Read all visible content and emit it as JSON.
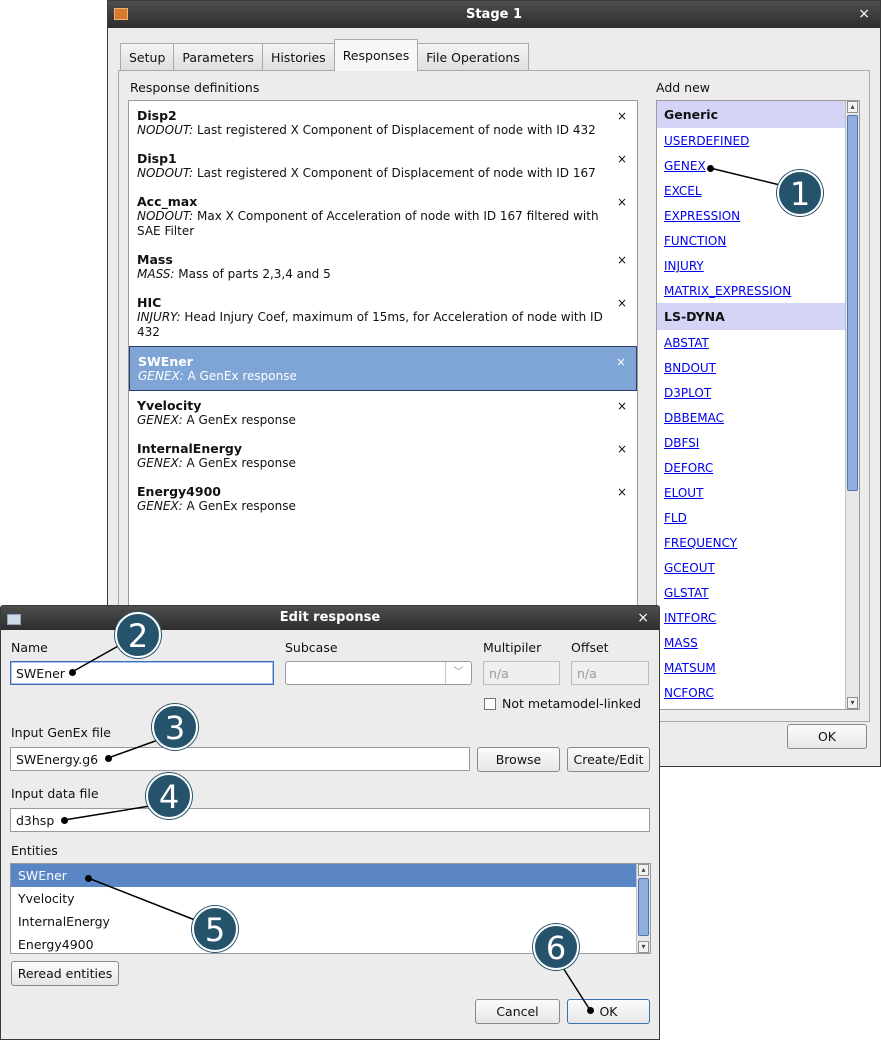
{
  "stage": {
    "title": "Stage 1",
    "close_glyph": "×",
    "tabs": [
      {
        "label": "Setup"
      },
      {
        "label": "Parameters"
      },
      {
        "label": "Histories"
      },
      {
        "label": "Responses",
        "active": true
      },
      {
        "label": "File Operations"
      }
    ],
    "response_definitions_label": "Response definitions",
    "add_new_label": "Add new",
    "remove_glyph": "×",
    "responses": [
      {
        "name": "Disp2",
        "type": "NODOUT:",
        "desc": "Last registered X Component of Displacement of node with ID 432"
      },
      {
        "name": "Disp1",
        "type": "NODOUT:",
        "desc": "Last registered X Component of Displacement of node with ID 167"
      },
      {
        "name": "Acc_max",
        "type": "NODOUT:",
        "desc": "Max X Component of Acceleration of node with ID 167 filtered with SAE Filter"
      },
      {
        "name": "Mass",
        "type": "MASS:",
        "desc": "Mass of parts 2,3,4 and 5"
      },
      {
        "name": "HIC",
        "type": "INJURY:",
        "desc": "Head Injury Coef, maximum of 15ms, for Acceleration of node with ID 432"
      },
      {
        "name": "SWEner",
        "type": "GENEX:",
        "desc": "A GenEx response",
        "selected": true
      },
      {
        "name": "Yvelocity",
        "type": "GENEX:",
        "desc": "A GenEx response"
      },
      {
        "name": "InternalEnergy",
        "type": "GENEX:",
        "desc": "A GenEx response"
      },
      {
        "name": "Energy4900",
        "type": "GENEX:",
        "desc": "A GenEx response"
      }
    ],
    "add_new": {
      "generic_header": "Generic",
      "generic": [
        "USERDEFINED",
        "GENEX",
        "EXCEL",
        "EXPRESSION",
        "FUNCTION",
        "INJURY",
        "MATRIX_EXPRESSION"
      ],
      "lsdyna_header": "LS-DYNA",
      "lsdyna": [
        "ABSTAT",
        "BNDOUT",
        "D3PLOT",
        "DBBEMAC",
        "DBFSI",
        "DEFORC",
        "ELOUT",
        "FLD",
        "FREQUENCY",
        "GCEOUT",
        "GLSTAT",
        "INTFORC",
        "MASS",
        "MATSUM",
        "NCFORC"
      ]
    },
    "ok_label": "OK"
  },
  "edit": {
    "title": "Edit response",
    "close_glyph": "×",
    "name_label": "Name",
    "name_value": "SWEner",
    "subcase_label": "Subcase",
    "subcase_value": "",
    "multiplier_label": "Multipiler",
    "multiplier_value": "n/a",
    "offset_label": "Offset",
    "offset_value": "n/a",
    "not_linked_label": "Not metamodel-linked",
    "genex_label": "Input GenEx file",
    "genex_value": "SWEnergy.g6",
    "browse_label": "Browse",
    "create_edit_label": "Create/Edit",
    "data_label": "Input data file",
    "data_value": "d3hsp",
    "entities_label": "Entities",
    "entities": [
      {
        "name": "SWEner",
        "selected": true
      },
      {
        "name": "Yvelocity"
      },
      {
        "name": "InternalEnergy"
      },
      {
        "name": "Energy4900"
      }
    ],
    "reread_label": "Reread entities",
    "cancel_label": "Cancel",
    "ok_label": "OK"
  },
  "callouts": [
    "1",
    "2",
    "3",
    "4",
    "5",
    "6"
  ],
  "colors": {
    "callout": "#25536c",
    "selection": "#7fa4d6",
    "link": "#0000ee",
    "group_header": "#d4d4f7"
  }
}
